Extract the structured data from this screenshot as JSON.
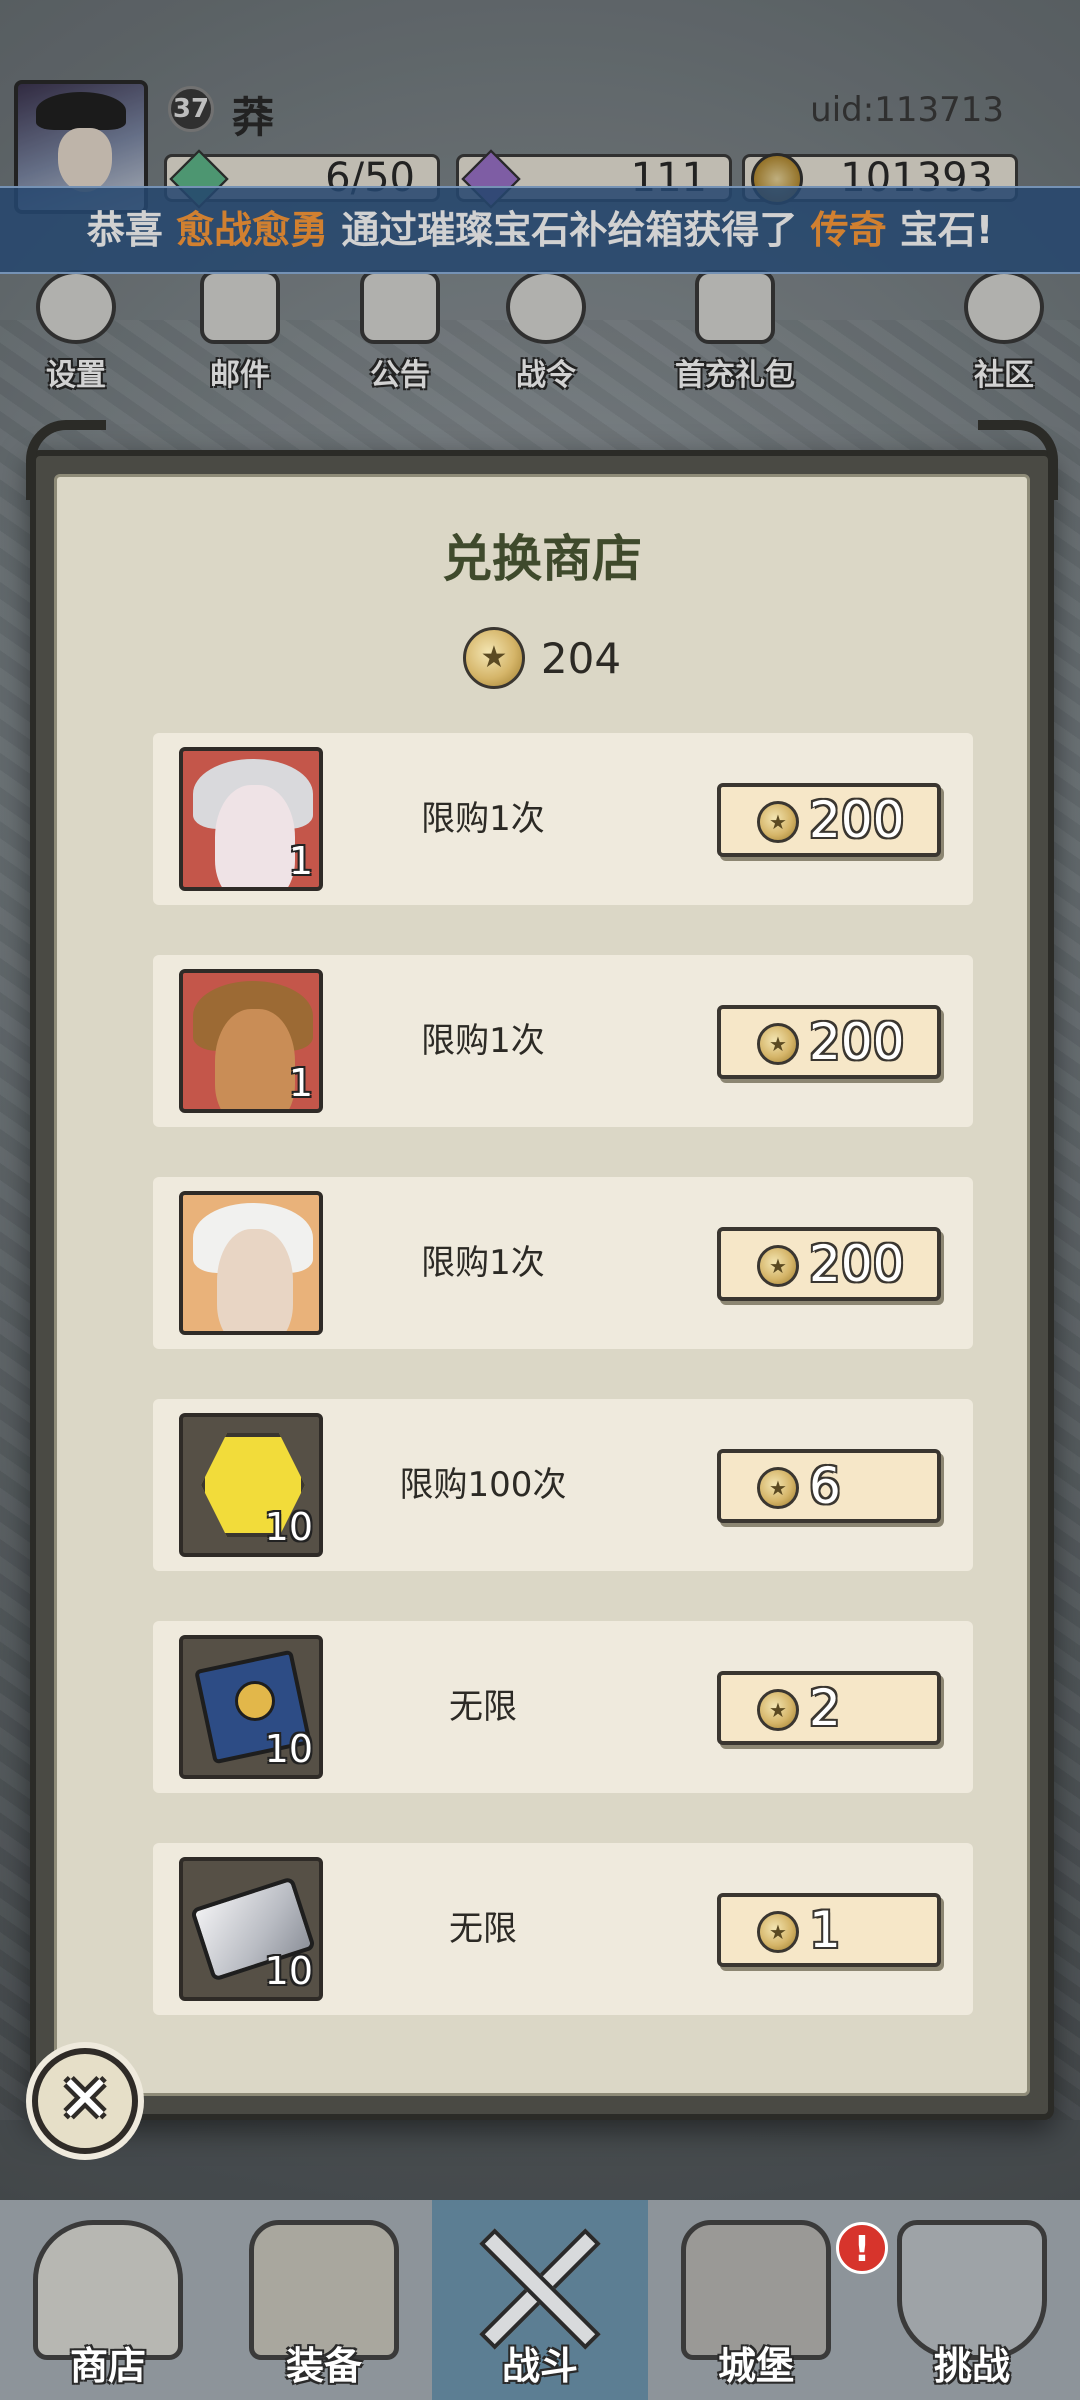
{
  "header": {
    "level": "37",
    "player_name": "莽",
    "uid": "uid:113713",
    "resources": {
      "stamina": "6/50",
      "gems": "111",
      "coins": "101393"
    }
  },
  "banner": {
    "prefix": "恭喜",
    "player": "愈战愈勇",
    "middle": "通过璀璨宝石补给箱获得了",
    "item": "传奇",
    "suffix": "宝石!"
  },
  "top_icons": [
    {
      "label": "设置",
      "icon": "gear-icon"
    },
    {
      "label": "邮件",
      "icon": "mail-icon"
    },
    {
      "label": "公告",
      "icon": "scroll-icon"
    },
    {
      "label": "战令",
      "icon": "battle-pass-icon"
    },
    {
      "label": "首充礼包",
      "icon": "gift-bag-icon"
    },
    {
      "label": "社区",
      "icon": "home-icon"
    }
  ],
  "shop": {
    "title": "兑换商店",
    "balance": "204",
    "items": [
      {
        "name": "hero-white-hair",
        "quantity": "1",
        "limit": "限购1次",
        "price": "200"
      },
      {
        "name": "hero-beast-warrior",
        "quantity": "1",
        "limit": "限购1次",
        "price": "200"
      },
      {
        "name": "hero-old-sage",
        "quantity": "1",
        "limit": "限购1次",
        "price": "200"
      },
      {
        "name": "gold-hexagon-gem",
        "quantity": "10",
        "limit": "限购100次",
        "price": "6"
      },
      {
        "name": "skill-book",
        "quantity": "10",
        "limit": "无限",
        "price": "2"
      },
      {
        "name": "silver-ingot",
        "quantity": "10",
        "limit": "无限",
        "price": "1"
      }
    ]
  },
  "close": {
    "icon": "close-icon"
  },
  "bottom_nav": [
    {
      "label": "商店",
      "icon": "shop-icon"
    },
    {
      "label": "装备",
      "icon": "backpack-icon"
    },
    {
      "label": "战斗",
      "icon": "crossed-swords-icon",
      "active": true
    },
    {
      "label": "城堡",
      "icon": "castle-icon"
    },
    {
      "label": "挑战",
      "icon": "shield-icon"
    }
  ],
  "alert_badge": "!"
}
